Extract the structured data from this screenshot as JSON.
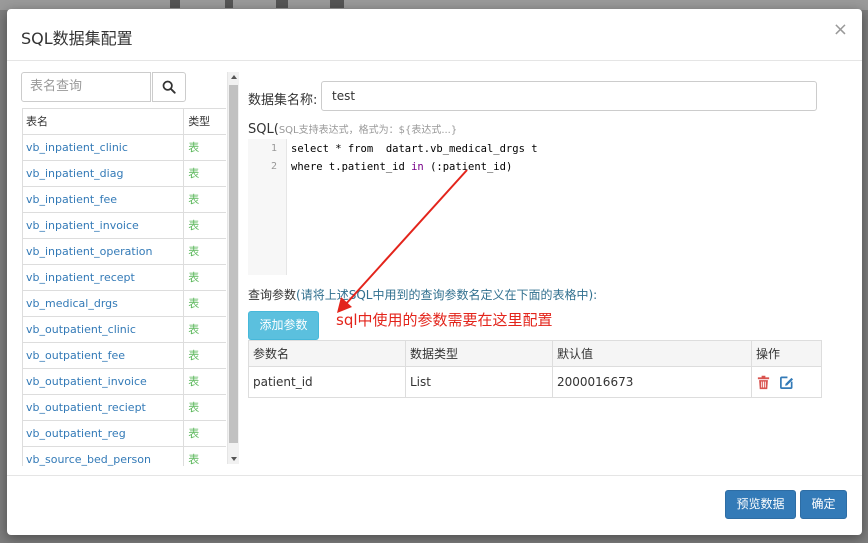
{
  "modal": {
    "title": "SQL数据集配置",
    "close": "×"
  },
  "left": {
    "search_placeholder": "表名查询",
    "col_name": "表名",
    "col_type": "类型",
    "tables": [
      {
        "name": "vb_inpatient_clinic",
        "type": "表"
      },
      {
        "name": "vb_inpatient_diag",
        "type": "表"
      },
      {
        "name": "vb_inpatient_fee",
        "type": "表"
      },
      {
        "name": "vb_inpatient_invoice",
        "type": "表"
      },
      {
        "name": "vb_inpatient_operation",
        "type": "表"
      },
      {
        "name": "vb_inpatient_recept",
        "type": "表"
      },
      {
        "name": "vb_medical_drgs",
        "type": "表"
      },
      {
        "name": "vb_outpatient_clinic",
        "type": "表"
      },
      {
        "name": "vb_outpatient_fee",
        "type": "表"
      },
      {
        "name": "vb_outpatient_invoice",
        "type": "表"
      },
      {
        "name": "vb_outpatient_reciept",
        "type": "表"
      },
      {
        "name": "vb_outpatient_reg",
        "type": "表"
      },
      {
        "name": "vb_source_bed_person",
        "type": "表"
      }
    ]
  },
  "dataset": {
    "name_label": "数据集名称:",
    "name_value": "test"
  },
  "sql": {
    "label": "SQL(",
    "hint": "SQL支持表达式，格式为：${表达式...}",
    "lines": [
      {
        "num": "1",
        "pre": "select * from  datart.vb_medical_drgs t",
        "kw": "",
        "post": ""
      },
      {
        "num": "2",
        "pre": "where t.patient_id ",
        "kw": "in",
        "post": " (:patient_id)"
      }
    ]
  },
  "params": {
    "label": "查询参数",
    "note": "(请将上述SQL中用到的查询参数名定义在下面的表格中):",
    "add_button": "添加参数",
    "headers": [
      "参数名",
      "数据类型",
      "默认值",
      "操作"
    ],
    "rows": [
      {
        "name": "patient_id",
        "type": "List",
        "default": "2000016673"
      }
    ]
  },
  "annotation": "sql中使用的参数需要在这里配置",
  "footer": {
    "preview": "预览数据",
    "ok": "确定"
  },
  "colors": {
    "primary": "#337ab7",
    "info": "#5bc0de",
    "link": "#337ab7",
    "success": "#5cb85c",
    "annotation": "#e3241b",
    "delete": "#d9534f"
  }
}
